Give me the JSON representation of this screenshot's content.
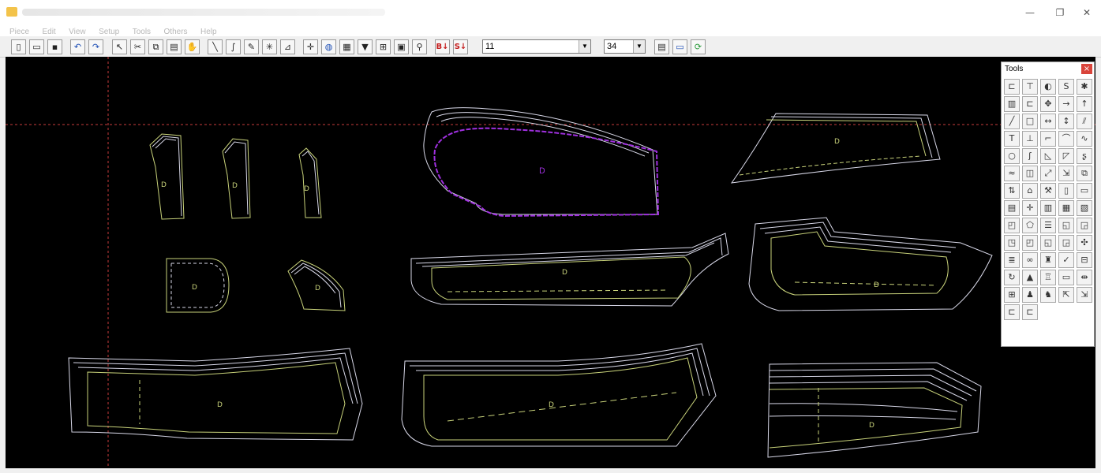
{
  "window": {
    "title": "",
    "controls": {
      "minimize": "—",
      "maximize": "❐",
      "close": "✕"
    }
  },
  "menu": [
    "Piece",
    "Edit",
    "View",
    "Setup",
    "Tools",
    "Others",
    "Help"
  ],
  "toolbar": {
    "size_value": "11",
    "size_value2": "34",
    "undo_label": "↶",
    "redo_label": "↷",
    "sort_up_label": "B↓",
    "sort_down_label": "S↓"
  },
  "tools_panel": {
    "title": "Tools",
    "close": "×"
  },
  "colors": {
    "canvas": "#000000",
    "piece_outline": "#c8d27a",
    "grade_line": "#d8d8e8",
    "selected": "#a030e0",
    "guide": "#c83c3c"
  },
  "icons": {
    "toolbar": [
      "new-file-icon",
      "open-folder-icon",
      "save-icon",
      "undo-icon",
      "redo-icon",
      "pointer-icon",
      "cut-icon",
      "copy-icon",
      "paste-icon",
      "hand-icon",
      "line-icon",
      "curve-icon",
      "pen-icon",
      "star-icon",
      "measure-icon",
      "cross-icon",
      "globe-icon",
      "layers-icon",
      "filter-icon",
      "notch-icon",
      "export-icon",
      "zoom-icon",
      "sort-up-icon",
      "sort-down-icon"
    ]
  }
}
